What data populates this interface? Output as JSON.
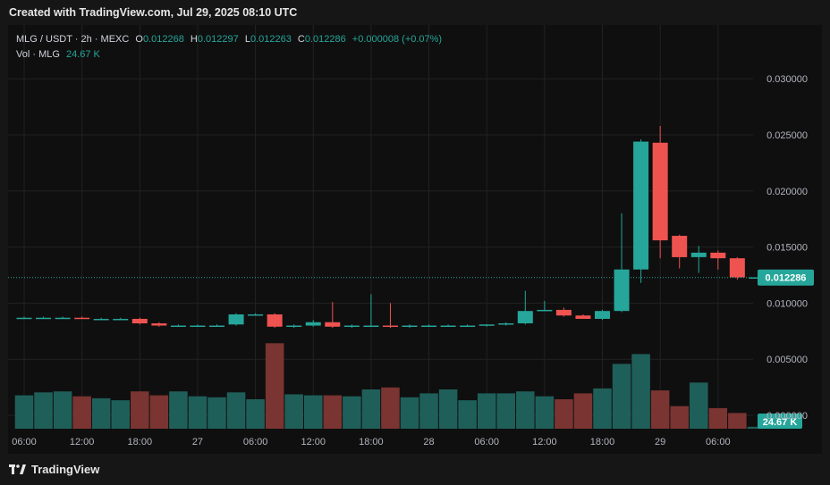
{
  "header": {
    "credit": "Created with TradingView.com, Jul 29, 2025 08:10 UTC"
  },
  "legend": {
    "symbol": "MLG / USDT · 2h · MEXC",
    "o_label": "O",
    "o_value": "0.012268",
    "h_label": "H",
    "h_value": "0.012297",
    "l_label": "L",
    "l_value": "0.012263",
    "c_label": "C",
    "c_value": "0.012286",
    "change": "+0.000008 (+0.07%)",
    "vol_label": "Vol · MLG",
    "vol_value": "24.67 K"
  },
  "footer": {
    "brand": "TradingView"
  },
  "colors": {
    "up": "#26a69a",
    "down": "#ef5350",
    "vol_up": "#1f5f5a",
    "vol_down": "#7a3431",
    "grid": "#222222",
    "price_tag": "#26a69a"
  },
  "chart_data": {
    "type": "candlestick",
    "symbol": "MLG / USDT",
    "interval": "2h",
    "exchange": "MEXC",
    "y_axis": {
      "ticks": [
        "0.030000",
        "0.025000",
        "0.020000",
        "0.015000",
        "0.010000",
        "0.005000",
        "0.000000"
      ],
      "ylim": [
        0.0,
        0.032
      ]
    },
    "x_axis": {
      "ticks": [
        "06:00",
        "12:00",
        "18:00",
        "27",
        "06:00",
        "12:00",
        "18:00",
        "28",
        "06:00",
        "12:00",
        "18:00",
        "29",
        "06:00"
      ]
    },
    "last_price": "0.012286",
    "last_volume": "24.67 K",
    "candles": [
      {
        "o": 0.0087,
        "h": 0.0088,
        "l": 0.0086,
        "c": 0.0087,
        "v": 0.34
      },
      {
        "o": 0.0087,
        "h": 0.0088,
        "l": 0.0086,
        "c": 0.0087,
        "v": 0.37
      },
      {
        "o": 0.0087,
        "h": 0.0088,
        "l": 0.0086,
        "c": 0.0087,
        "v": 0.38
      },
      {
        "o": 0.0087,
        "h": 0.0088,
        "l": 0.0086,
        "c": 0.0086,
        "v": 0.33
      },
      {
        "o": 0.0086,
        "h": 0.0087,
        "l": 0.0085,
        "c": 0.0086,
        "v": 0.31
      },
      {
        "o": 0.0086,
        "h": 0.0087,
        "l": 0.0085,
        "c": 0.0086,
        "v": 0.29
      },
      {
        "o": 0.0086,
        "h": 0.0087,
        "l": 0.0081,
        "c": 0.0082,
        "v": 0.38
      },
      {
        "o": 0.0082,
        "h": 0.0083,
        "l": 0.0079,
        "c": 0.008,
        "v": 0.34
      },
      {
        "o": 0.008,
        "h": 0.0081,
        "l": 0.0079,
        "c": 0.008,
        "v": 0.38
      },
      {
        "o": 0.008,
        "h": 0.0081,
        "l": 0.0079,
        "c": 0.008,
        "v": 0.33
      },
      {
        "o": 0.008,
        "h": 0.0081,
        "l": 0.0079,
        "c": 0.008,
        "v": 0.32
      },
      {
        "o": 0.0081,
        "h": 0.0091,
        "l": 0.008,
        "c": 0.009,
        "v": 0.37
      },
      {
        "o": 0.009,
        "h": 0.0091,
        "l": 0.0089,
        "c": 0.009,
        "v": 0.3
      },
      {
        "o": 0.009,
        "h": 0.0091,
        "l": 0.0078,
        "c": 0.0079,
        "v": 0.87
      },
      {
        "o": 0.0079,
        "h": 0.0081,
        "l": 0.0078,
        "c": 0.008,
        "v": 0.35
      },
      {
        "o": 0.008,
        "h": 0.0085,
        "l": 0.0079,
        "c": 0.0083,
        "v": 0.34
      },
      {
        "o": 0.0083,
        "h": 0.0101,
        "l": 0.0078,
        "c": 0.0079,
        "v": 0.34
      },
      {
        "o": 0.0079,
        "h": 0.0081,
        "l": 0.0078,
        "c": 0.008,
        "v": 0.33
      },
      {
        "o": 0.008,
        "h": 0.0108,
        "l": 0.0079,
        "c": 0.008,
        "v": 0.4
      },
      {
        "o": 0.008,
        "h": 0.01,
        "l": 0.0078,
        "c": 0.0079,
        "v": 0.42
      },
      {
        "o": 0.0079,
        "h": 0.0081,
        "l": 0.0078,
        "c": 0.008,
        "v": 0.32
      },
      {
        "o": 0.008,
        "h": 0.0081,
        "l": 0.0079,
        "c": 0.008,
        "v": 0.36
      },
      {
        "o": 0.008,
        "h": 0.0081,
        "l": 0.0079,
        "c": 0.008,
        "v": 0.4
      },
      {
        "o": 0.008,
        "h": 0.0081,
        "l": 0.0079,
        "c": 0.008,
        "v": 0.29
      },
      {
        "o": 0.008,
        "h": 0.0081,
        "l": 0.0079,
        "c": 0.0081,
        "v": 0.36
      },
      {
        "o": 0.0081,
        "h": 0.0083,
        "l": 0.008,
        "c": 0.0082,
        "v": 0.36
      },
      {
        "o": 0.0082,
        "h": 0.0111,
        "l": 0.0081,
        "c": 0.0093,
        "v": 0.38
      },
      {
        "o": 0.0094,
        "h": 0.0102,
        "l": 0.0093,
        "c": 0.0094,
        "v": 0.33
      },
      {
        "o": 0.0094,
        "h": 0.0096,
        "l": 0.0088,
        "c": 0.0089,
        "v": 0.3
      },
      {
        "o": 0.0089,
        "h": 0.009,
        "l": 0.0086,
        "c": 0.0086,
        "v": 0.36
      },
      {
        "o": 0.0086,
        "h": 0.0094,
        "l": 0.0085,
        "c": 0.0093,
        "v": 0.41
      },
      {
        "o": 0.0093,
        "h": 0.018,
        "l": 0.0092,
        "c": 0.013,
        "v": 0.66
      },
      {
        "o": 0.013,
        "h": 0.0246,
        "l": 0.0118,
        "c": 0.0244,
        "v": 0.76
      },
      {
        "o": 0.0243,
        "h": 0.0258,
        "l": 0.014,
        "c": 0.0156,
        "v": 0.39
      },
      {
        "o": 0.016,
        "h": 0.0161,
        "l": 0.0131,
        "c": 0.0141,
        "v": 0.23
      },
      {
        "o": 0.0141,
        "h": 0.0151,
        "l": 0.0127,
        "c": 0.0145,
        "v": 0.47
      },
      {
        "o": 0.0145,
        "h": 0.0147,
        "l": 0.013,
        "c": 0.014,
        "v": 0.21
      },
      {
        "o": 0.014,
        "h": 0.0141,
        "l": 0.0121,
        "c": 0.0123,
        "v": 0.16
      },
      {
        "o": 0.0123,
        "h": 0.0123,
        "l": 0.0123,
        "c": 0.0123,
        "v": 0.02
      }
    ]
  }
}
